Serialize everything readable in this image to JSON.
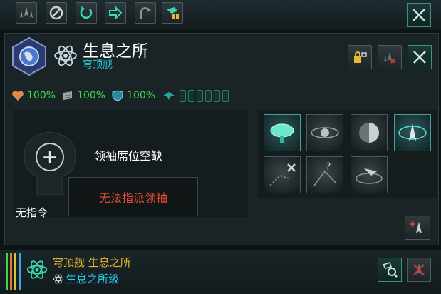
{
  "header": {
    "title": "生息之所",
    "subtitle": "穹顶舰"
  },
  "stats": {
    "hull_pct": "100%",
    "armor_pct": "100%",
    "shield_pct": "100%",
    "pips_total": 6
  },
  "leader": {
    "vacant_text": "领袖席位空缺",
    "warning_text": "无法指派领袖",
    "no_order_text": "无指令"
  },
  "footer": {
    "line1": "穹顶舰 生息之所",
    "line2": "生息之所级"
  },
  "colors": {
    "accent": "#28c8d8",
    "ok": "#3ad84a",
    "warning": "#e84a3a",
    "name_gold": "#e8b830"
  }
}
